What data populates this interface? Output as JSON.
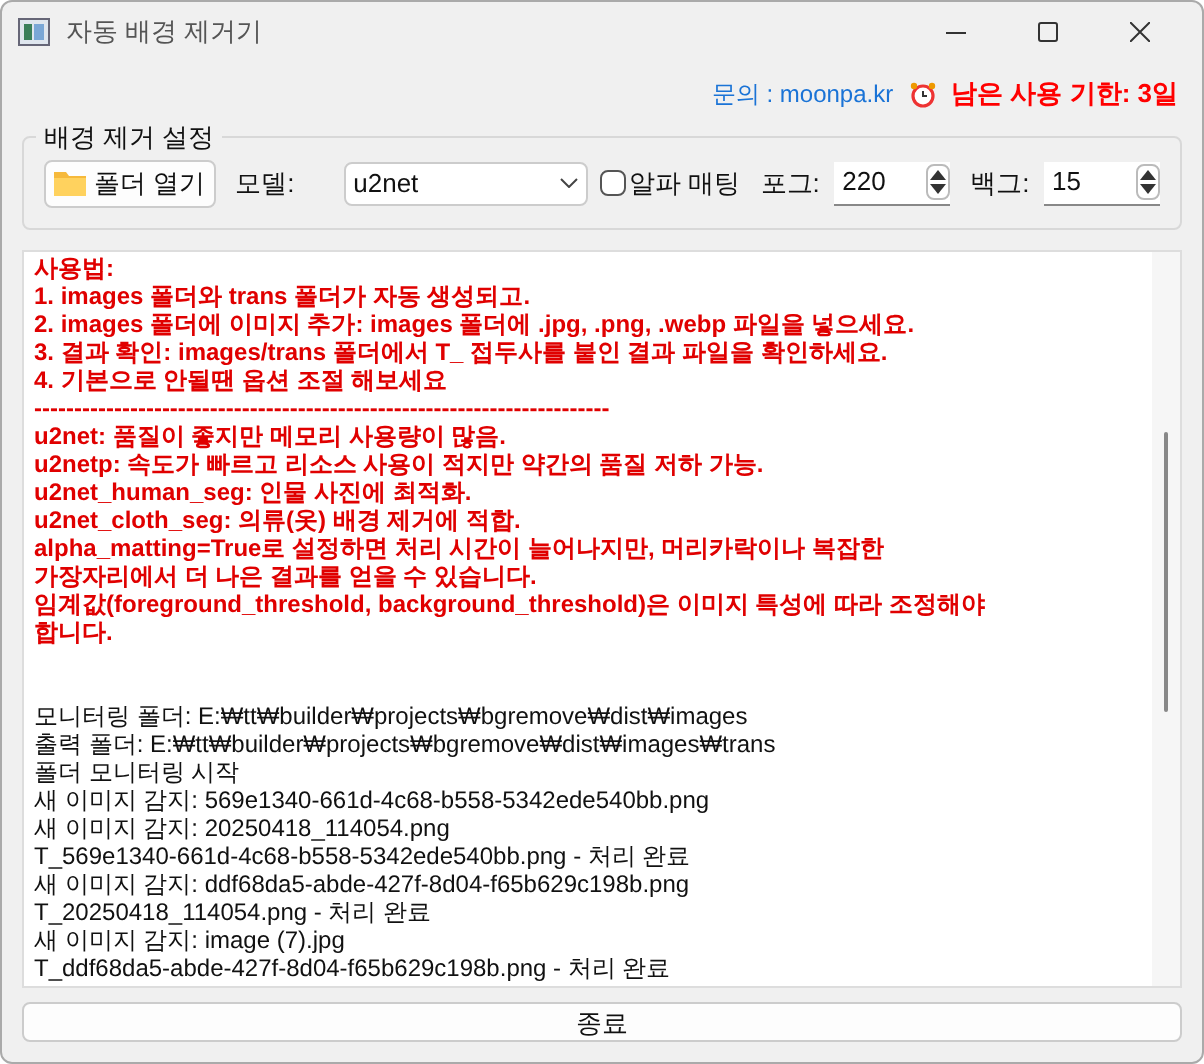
{
  "window": {
    "title": "자동 배경 제거기"
  },
  "header": {
    "contact": "문의 : moonpa.kr",
    "deadline": "남은 사용 기한: 3일"
  },
  "settings": {
    "title": "배경 제거 설정",
    "open_folder_button": "폴더 열기",
    "model_label": "모델:",
    "model_value": "u2net",
    "alpha_matting": {
      "label": "알파 매팅",
      "checked": false
    },
    "foreground": {
      "label": "포그:",
      "value": "220"
    },
    "background": {
      "label": "백그:",
      "value": "15"
    }
  },
  "instructions": [
    "사용법:",
    "1. images 폴더와 trans 폴더가 자동 생성되고.",
    "2. images 폴더에 이미지 추가: images 폴더에 .jpg, .png, .webp 파일을 넣으세요.",
    "3. 결과 확인: images/trans 폴더에서 T_ 접두사를 붙인 결과 파일을 확인하세요.",
    "4. 기본으로 안될땐 옵션 조절 해보세요",
    "------------------------------------------------------------------------",
    "u2net: 품질이 좋지만 메모리 사용량이 많음.",
    "u2netp: 속도가 빠르고 리소스 사용이 적지만 약간의 품질 저하 가능.",
    "u2net_human_seg: 인물 사진에 최적화.",
    "u2net_cloth_seg: 의류(옷) 배경 제거에 적합.",
    "alpha_matting=True로 설정하면 처리 시간이 늘어나지만, 머리카락이나 복잡한",
    "가장자리에서 더 나은 결과를 얻을 수 있습니다.",
    "임계값(foreground_threshold, background_threshold)은 이미지 특성에 따라 조정해야",
    "합니다."
  ],
  "log": [
    "모니터링 폴더: E:₩tt₩builder₩projects₩bgremove₩dist₩images",
    "출력 폴더: E:₩tt₩builder₩projects₩bgremove₩dist₩images₩trans",
    "폴더 모니터링 시작",
    "새 이미지 감지: 569e1340-661d-4c68-b558-5342ede540bb.png",
    "새 이미지 감지: 20250418_114054.png",
    "T_569e1340-661d-4c68-b558-5342ede540bb.png - 처리 완료",
    "새 이미지 감지: ddf68da5-abde-427f-8d04-f65b629c198b.png",
    "T_20250418_114054.png - 처리 완료",
    "새 이미지 감지: image (7).jpg",
    "T_ddf68da5-abde-427f-8d04-f65b629c198b.png - 처리 완료"
  ],
  "exit_button": "종료"
}
